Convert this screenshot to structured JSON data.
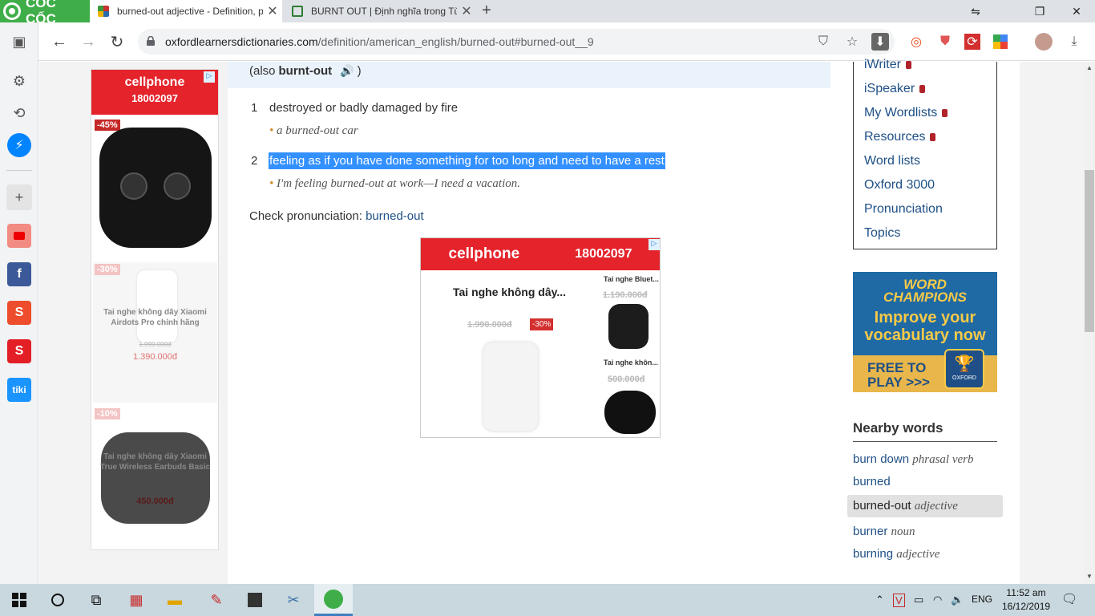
{
  "browser": {
    "brand": "CỐC CỐC",
    "tabs": [
      {
        "title": "burned-out adjective - Definition, p",
        "active": true
      },
      {
        "title": "BURNT OUT | Định nghĩa trong Từ",
        "active": false
      }
    ],
    "url_host": "oxfordlearnersdictionaries.com",
    "url_path": "/definition/american_english/burned-out#burned-out__9"
  },
  "definition": {
    "also_prefix": "(also",
    "also_word": "burnt-out",
    "also_suffix": ")",
    "senses": [
      {
        "num": "1",
        "text": "destroyed or badly damaged by fire",
        "example": "a burned-out car"
      },
      {
        "num": "2",
        "text": "feeling as if you have done something for too long and need to have a rest",
        "example": "I'm feeling burned-out at work—I need a vacation."
      }
    ],
    "check_label": "Check pronunciation:",
    "check_link": "burned-out"
  },
  "left_ad": {
    "brand": "cellphone",
    "phone": "18002097",
    "items": [
      {
        "badge": "-45%",
        "name": "",
        "old_price": "",
        "price": ""
      },
      {
        "badge": "-30%",
        "name": "Tai nghe không dây Xiaomi Airdots Pro chính hãng",
        "old_price": "1.990.000đ",
        "price": "1.390.000đ"
      },
      {
        "badge": "-10%",
        "name": "Tai nghe không dây Xiaomi True Wireless Earbuds Basic",
        "old_price": "",
        "price": "450.000đ"
      }
    ]
  },
  "center_ad": {
    "brand": "cellphone",
    "phone": "18002097",
    "main_title": "Tai nghe không dây...",
    "main_old_price": "1.990.000đ",
    "main_badge": "-30%",
    "side": [
      {
        "title": "Tai nghe Bluet...",
        "old_price": "1.190.000đ"
      },
      {
        "title": "Tai nghe khôn...",
        "old_price": "500.000đ"
      }
    ]
  },
  "right_menu": [
    {
      "label": "iWriter",
      "locked": true
    },
    {
      "label": "iSpeaker",
      "locked": true
    },
    {
      "label": "My Wordlists",
      "locked": true
    },
    {
      "label": "Resources",
      "locked": true
    },
    {
      "label": "Word lists",
      "locked": false
    },
    {
      "label": "Oxford 3000",
      "locked": false
    },
    {
      "label": "Pronunciation",
      "locked": false
    },
    {
      "label": "Topics",
      "locked": false
    }
  ],
  "word_champions": {
    "logo_line1": "WORD",
    "logo_line2": "CHAMPIONS",
    "headline1": "Improve your",
    "headline2": "vocabulary now",
    "cta1": "FREE TO",
    "cta2": "PLAY >>>",
    "badge": "OXFORD"
  },
  "nearby": {
    "title": "Nearby words",
    "items": [
      {
        "word": "burn down",
        "pos": "phrasal verb",
        "current": false
      },
      {
        "word": "burned",
        "pos": "",
        "current": false
      },
      {
        "word": "burned-out",
        "pos": "adjective",
        "current": true
      },
      {
        "word": "burner",
        "pos": "noun",
        "current": false
      },
      {
        "word": "burning",
        "pos": "adjective",
        "current": false
      }
    ]
  },
  "taskbar": {
    "lang": "ENG",
    "time": "11:52 am",
    "date": "16/12/2019"
  },
  "colors": {
    "selection": "#3390ff",
    "link": "#1e4f86",
    "adRed": "#e4232b",
    "coccocGreen": "#3fae49"
  }
}
